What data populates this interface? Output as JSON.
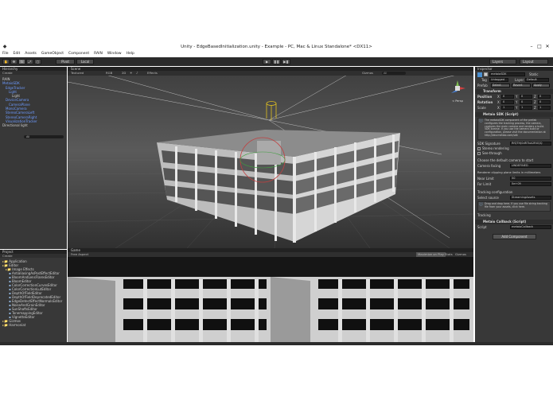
{
  "window": {
    "title": "Unity - EdgeBasedInitialization.unity - Example - PC, Mac & Linux Standalone* <DX11>"
  },
  "menu": [
    "File",
    "Edit",
    "Assets",
    "GameObject",
    "Component",
    "RAIN",
    "Window",
    "Help"
  ],
  "toolbar": {
    "pivot": "Pivot",
    "local": "Local",
    "layers": "Layers",
    "layout": "Layout"
  },
  "hierarchy": {
    "tab": "Hierarchy",
    "create": "Create",
    "search": "All",
    "items": [
      {
        "label": "RAIN",
        "indent": 0,
        "blue": false
      },
      {
        "label": "MetaioSDK",
        "indent": 0,
        "blue": true
      },
      {
        "label": "EdgeTracker",
        "indent": 1,
        "blue": true
      },
      {
        "label": "Light",
        "indent": 2,
        "blue": true
      },
      {
        "label": "Light",
        "indent": 3,
        "blue": false
      },
      {
        "label": "DeviceCamera",
        "indent": 1,
        "blue": true
      },
      {
        "label": "CameraPlane",
        "indent": 2,
        "blue": true
      },
      {
        "label": "MonoCamera",
        "indent": 1,
        "blue": true
      },
      {
        "label": "StereoCameraLeft",
        "indent": 1,
        "blue": true
      },
      {
        "label": "StereoCameraRight",
        "indent": 1,
        "blue": true
      },
      {
        "label": "VisualizationTracker",
        "indent": 1,
        "blue": true
      },
      {
        "label": "Directional light",
        "indent": 0,
        "blue": false
      }
    ]
  },
  "project": {
    "tab": "Project",
    "create": "Create",
    "items": [
      {
        "label": "Application",
        "indent": 0
      },
      {
        "label": "Editor",
        "indent": 0
      },
      {
        "label": "Image Effects",
        "indent": 1
      },
      {
        "label": "AntialiasingAsPostEffectEditor",
        "indent": 2
      },
      {
        "label": "BloomAndLensFlaresEditor",
        "indent": 2
      },
      {
        "label": "BloomEditor",
        "indent": 2
      },
      {
        "label": "ColorCorrectionCurvesEditor",
        "indent": 2
      },
      {
        "label": "ColorCorrectionLutEditor",
        "indent": 2
      },
      {
        "label": "DepthOfFieldEditor",
        "indent": 2
      },
      {
        "label": "DepthOfFieldDeprecatedEditor",
        "indent": 2
      },
      {
        "label": "EdgeDetectEffectNormalsEditor",
        "indent": 2
      },
      {
        "label": "NoiseAndGrainEditor",
        "indent": 2
      },
      {
        "label": "SunShaftsEditor",
        "indent": 2
      },
      {
        "label": "TonemappingEditor",
        "indent": 2
      },
      {
        "label": "VignetteEditor",
        "indent": 2
      },
      {
        "label": "Gizmos",
        "indent": 0
      },
      {
        "label": "Harmoniat",
        "indent": 0
      }
    ]
  },
  "scene": {
    "tab": "Scene",
    "shading": "Textured",
    "rgb": "RGB",
    "mode2d": "2D",
    "effects": "Effects",
    "gizmos": "Gizmos",
    "search": "All",
    "persp": "< Persp"
  },
  "game": {
    "tab": "Game",
    "aspect": "Free Aspect",
    "maximize": "Maximize on Play",
    "stats": "Stats",
    "gizmos": "Gizmos"
  },
  "inspector": {
    "tab": "Inspector",
    "object_name": "metaioSDK",
    "static": "Static",
    "tag_label": "Tag",
    "tag_value": "Untagged",
    "layer_label": "Layer",
    "layer_value": "Default",
    "prefab_label": "Prefab",
    "prefab_select": "Select",
    "prefab_revert": "Revert",
    "prefab_apply": "Apply",
    "transform_title": "Transform",
    "position_label": "Position",
    "rotation_label": "Rotation",
    "scale_label": "Scale",
    "position": {
      "x": "0",
      "y": "0",
      "z": "0"
    },
    "rotation": {
      "x": "0",
      "y": "0",
      "z": "0"
    },
    "scale": {
      "x": "1",
      "y": "1",
      "z": "1"
    },
    "metaio_title": "Metaio SDK (Script)",
    "help_text": "The metaioSDK component of the prefab configures the tracking process, the camera, captures the main camera and renders a build. 5DK license. If you use the camera build or configuration, please visit the documentation at http://dev.metaio.com/sdk",
    "sdk_signature_label": "SDK Signature",
    "sdk_signature_value": "RfQTHJ0dR7bA2RXQQ",
    "stereo_label": "Stereo rendering",
    "seethrough_label": "See-through",
    "default_camera_label": "Choose the default camera to start",
    "camera_facing_label": "Camera facing",
    "camera_facing_value": "UNDEFINED",
    "renderer_label": "Renderer clipping plane limits in millimeters",
    "near_label": "Near Limit",
    "near_value": "50",
    "far_label": "Far Limit",
    "far_value": "5e+09",
    "tracking_cfg_label": "Tracking configuration",
    "select_source_label": "Select source",
    "select_source_value": "StreamingAssets",
    "tracking_help": "Drag and drop here. If you use file string tracking file from your assets, click here.",
    "tracking_label": "Tracking",
    "callback_title": "Metaio Callback (Script)",
    "script_label": "Script",
    "script_value": "metaioCallback",
    "add_component": "Add Component"
  }
}
